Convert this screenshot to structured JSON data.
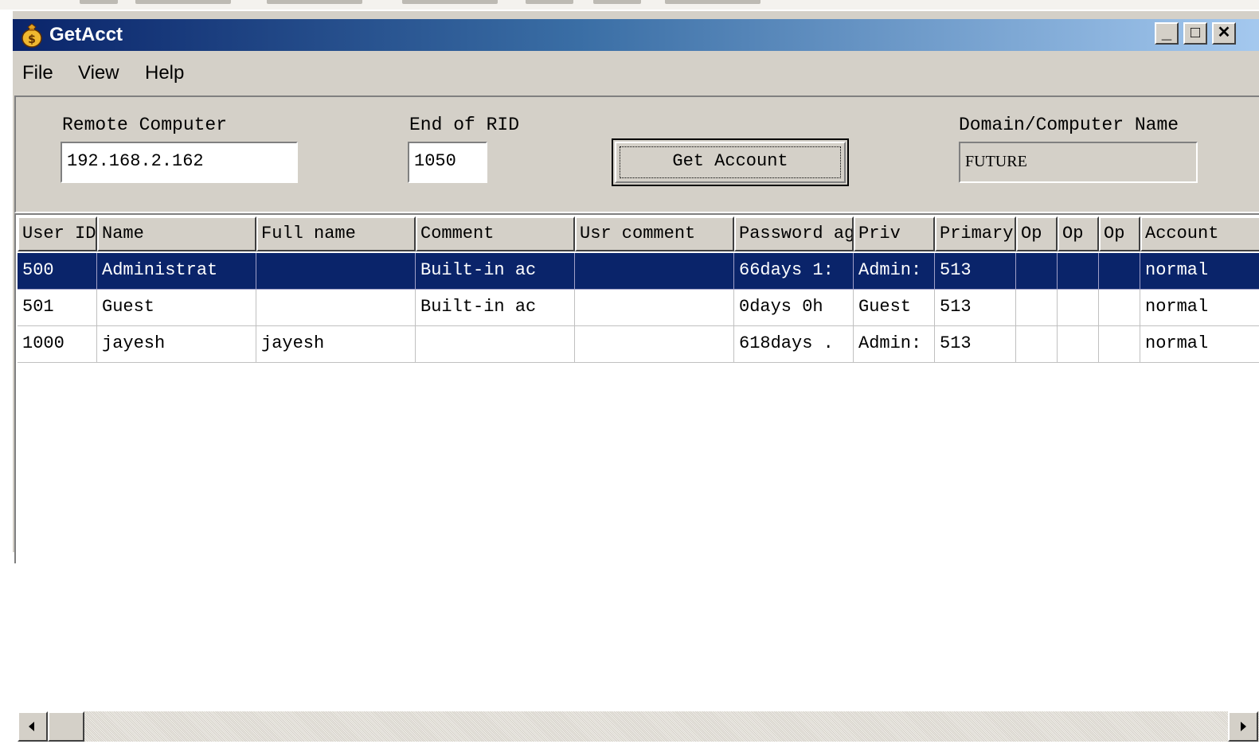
{
  "window": {
    "title": "GetAcct",
    "controls": {
      "minimize": "_",
      "maximize": "□",
      "close": "✕"
    }
  },
  "menu": [
    "File",
    "View",
    "Help"
  ],
  "form": {
    "remote_computer_label": "Remote Computer",
    "remote_computer_value": "192.168.2.162",
    "end_rid_label": "End of RID",
    "end_rid_value": "1050",
    "get_account_button": "Get Account",
    "domain_label": "Domain/Computer Name",
    "domain_value": "FUTURE"
  },
  "table": {
    "columns": [
      "User ID",
      "Name",
      "Full name",
      "Comment",
      "Usr comment",
      "Password age",
      "Priv",
      "Primary group",
      "Op",
      "Op",
      "Op",
      "Account"
    ],
    "rows": [
      [
        "500",
        "Administrat",
        "",
        "Built-in ac",
        "",
        "66days 1:",
        "Admin:",
        "513",
        "",
        "",
        "",
        "normal"
      ],
      [
        "501",
        "Guest",
        "",
        "Built-in ac",
        "",
        "0days 0h",
        "Guest",
        "513",
        "",
        "",
        "",
        "normal"
      ],
      [
        "1000",
        "jayesh",
        "jayesh",
        "",
        "",
        "618days .",
        "Admin:",
        "513",
        "",
        "",
        "",
        "normal"
      ]
    ],
    "selected_row": 0
  },
  "colors": {
    "title_start": "#0a246a",
    "title_end": "#a6caf0",
    "selection": "#0a246a",
    "face": "#d4d0c8"
  }
}
